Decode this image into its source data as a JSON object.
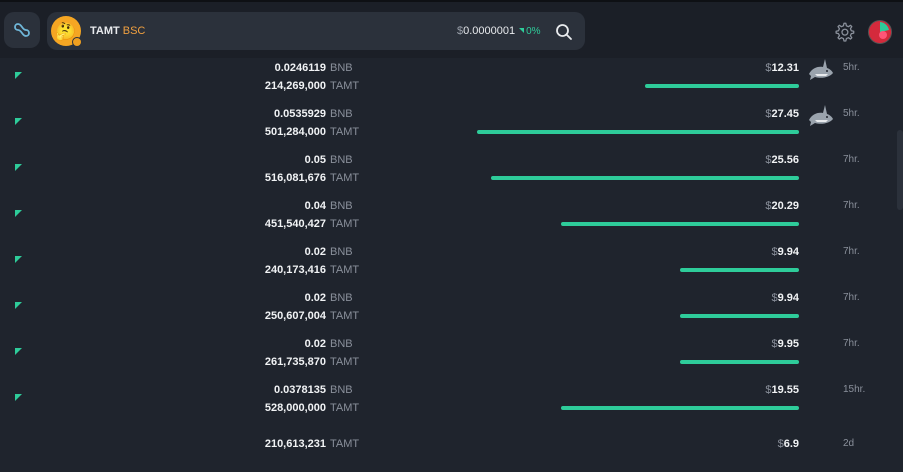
{
  "header": {
    "token_name": "TAMT",
    "token_chain": "BSC",
    "token_avatar_glyph": "🤔",
    "price_symbol": "$",
    "price_value": "0.0000001",
    "price_change": "0%"
  },
  "colors": {
    "accent": "#2ecc9a",
    "chain": "#f0a040",
    "background": "#1f242d",
    "header": "#1b1f27"
  },
  "icons": {
    "logo": "infinity-logo-icon",
    "search": "search-icon",
    "settings": "gear-icon",
    "avatar": "user-avatar",
    "row_marker": "buy-triangle-icon",
    "whale": "shark-icon"
  },
  "trades": [
    {
      "bnb": "0.0246119",
      "bnb_unit": "BNB",
      "tokens": "214,269,000",
      "token_unit": "TAMT",
      "usd_sym": "$",
      "usd": "12.31",
      "bar_fraction": 0.11,
      "shark": true,
      "age": "5hr."
    },
    {
      "bnb": "0.0535929",
      "bnb_unit": "BNB",
      "tokens": "501,284,000",
      "token_unit": "TAMT",
      "usd_sym": "$",
      "usd": "27.45",
      "bar_fraction": 0.23,
      "shark": true,
      "age": "5hr."
    },
    {
      "bnb": "0.05",
      "bnb_unit": "BNB",
      "tokens": "516,081,676",
      "token_unit": "TAMT",
      "usd_sym": "$",
      "usd": "25.56",
      "bar_fraction": 0.22,
      "shark": false,
      "age": "7hr."
    },
    {
      "bnb": "0.04",
      "bnb_unit": "BNB",
      "tokens": "451,540,427",
      "token_unit": "TAMT",
      "usd_sym": "$",
      "usd": "20.29",
      "bar_fraction": 0.17,
      "shark": false,
      "age": "7hr."
    },
    {
      "bnb": "0.02",
      "bnb_unit": "BNB",
      "tokens": "240,173,416",
      "token_unit": "TAMT",
      "usd_sym": "$",
      "usd": "9.94",
      "bar_fraction": 0.085,
      "shark": false,
      "age": "7hr."
    },
    {
      "bnb": "0.02",
      "bnb_unit": "BNB",
      "tokens": "250,607,004",
      "token_unit": "TAMT",
      "usd_sym": "$",
      "usd": "9.94",
      "bar_fraction": 0.085,
      "shark": false,
      "age": "7hr."
    },
    {
      "bnb": "0.02",
      "bnb_unit": "BNB",
      "tokens": "261,735,870",
      "token_unit": "TAMT",
      "usd_sym": "$",
      "usd": "9.95",
      "bar_fraction": 0.085,
      "shark": false,
      "age": "7hr."
    },
    {
      "bnb": "0.0378135",
      "bnb_unit": "BNB",
      "tokens": "528,000,000",
      "token_unit": "TAMT",
      "usd_sym": "$",
      "usd": "19.55",
      "bar_fraction": 0.17,
      "shark": false,
      "age": "15hr."
    },
    {
      "bnb": "",
      "bnb_unit": "",
      "tokens": "210,613,231",
      "token_unit": "TAMT",
      "usd_sym": "$",
      "usd": "6.9",
      "bar_fraction": 0,
      "shark": false,
      "age": "2d",
      "partial": true
    }
  ]
}
